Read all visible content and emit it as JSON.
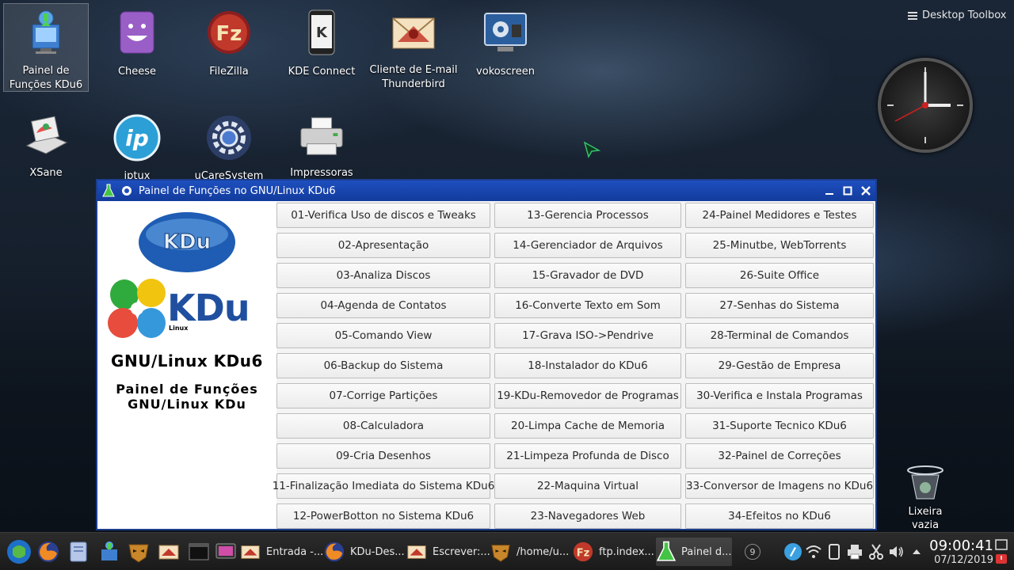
{
  "desktop": {
    "icons": [
      {
        "label": "Painel de Funções KDu6"
      },
      {
        "label": "Cheese"
      },
      {
        "label": "FileZilla"
      },
      {
        "label": "KDE Connect"
      },
      {
        "label": "Cliente de E-mail Thunderbird"
      },
      {
        "label": "vokoscreen"
      },
      {
        "label": "XSane"
      },
      {
        "label": "iptux"
      },
      {
        "label": "uCareSystem"
      },
      {
        "label": "Impressoras"
      }
    ],
    "toolbox_label": "Desktop Toolbox",
    "trash_label": "Lixeira vazia"
  },
  "window": {
    "title": "Painel de Funções no GNU/Linux KDu6",
    "logo_text": "KDu",
    "logo_sub": "Linux",
    "brand_title": "GNU/Linux KDu6",
    "brand_line1": "Painel de Funções",
    "brand_line2": "GNU/Linux KDu",
    "columns": [
      [
        "01-Verifica Uso de discos e Tweaks",
        "02-Apresentação",
        "03-Analiza Discos",
        "04-Agenda de Contatos",
        "05-Comando View",
        "06-Backup do Sistema",
        "07-Corrige Partições",
        "08-Calculadora",
        "09-Cria Desenhos",
        "11-Finalização Imediata do Sistema KDu6",
        "12-PowerBotton no Sistema KDu6"
      ],
      [
        "13-Gerencia Processos",
        "14-Gerenciador de Arquivos",
        "15-Gravador de DVD",
        "16-Converte Texto em Som",
        "17-Grava ISO->Pendrive",
        "18-Instalador do KDu6",
        "19-KDu-Removedor de Programas",
        "20-Limpa Cache de Memoria",
        "21-Limpeza Profunda de Disco",
        "22-Maquina Virtual",
        "23-Navegadores Web"
      ],
      [
        "24-Painel Medidores e Testes",
        "25-Minutbe, WebTorrents",
        "26-Suite Office",
        "27-Senhas do Sistema",
        "28-Terminal de Comandos",
        "29-Gestão de Empresa",
        "30-Verifica e Instala Programas",
        "31-Suporte Tecnico KDu6",
        "32-Painel de Correções",
        "33-Conversor de Imagens no KDu6",
        "34-Efeitos no KDu6"
      ]
    ]
  },
  "taskbar": {
    "tasks": [
      {
        "label": "Entrada -..."
      },
      {
        "label": "KDu-Des..."
      },
      {
        "label": "Escrever:..."
      },
      {
        "label": "/home/u..."
      },
      {
        "label": "ftp.index..."
      },
      {
        "label": "Painel d..."
      }
    ],
    "badge_count": "9",
    "time": "09:00:41",
    "date": "07/12/2019"
  }
}
